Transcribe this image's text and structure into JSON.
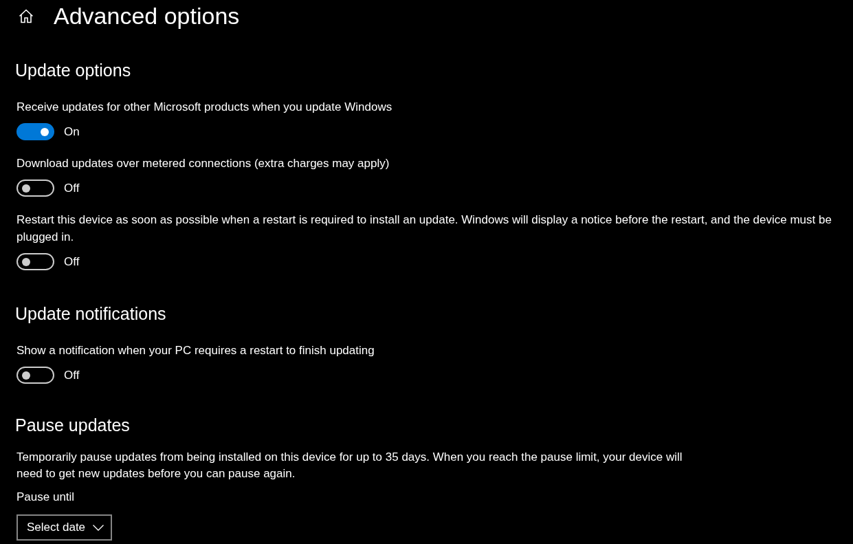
{
  "page": {
    "title": "Advanced options"
  },
  "sections": [
    {
      "kind": "toggles",
      "heading": "Update options",
      "settings": [
        {
          "lines": [
            "Receive updates for other Microsoft products when you update Windows"
          ],
          "on": true,
          "state_label": "On"
        },
        {
          "lines": [
            "Download updates over metered connections (extra charges may apply)"
          ],
          "on": false,
          "state_label": "Off"
        },
        {
          "lines": [
            "Restart this device as soon as possible when a restart is required to install an update. Windows will display a notice before the restart, and the device must be",
            "plugged in."
          ],
          "on": false,
          "state_label": "Off"
        }
      ]
    },
    {
      "kind": "toggles",
      "heading": "Update notifications",
      "settings": [
        {
          "lines": [
            "Show a notification when your PC requires a restart to finish updating"
          ],
          "on": false,
          "state_label": "Off"
        }
      ]
    },
    {
      "kind": "pause",
      "heading": "Pause updates",
      "description": "Temporarily pause updates from being installed on this device for up to 35 days. When you reach the pause limit, your device will need to get new updates before you can pause again.",
      "field_label": "Pause until",
      "dropdown": {
        "value": "Select date"
      }
    }
  ]
}
